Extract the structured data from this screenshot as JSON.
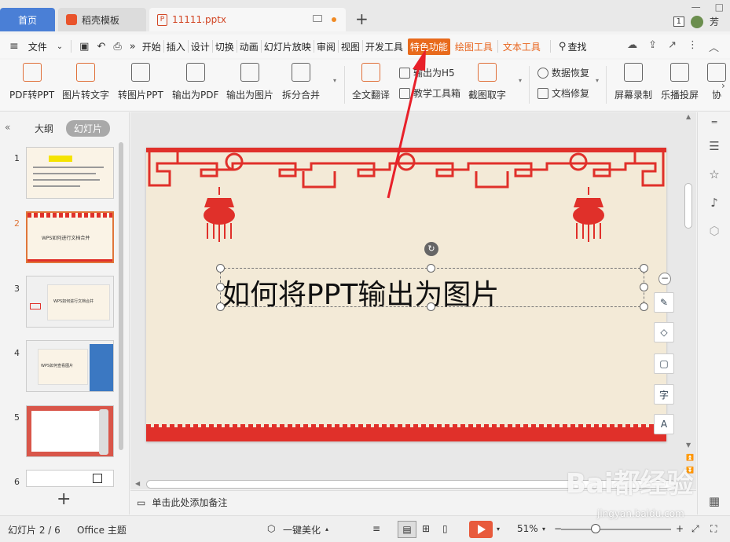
{
  "tabs": {
    "home": "首页",
    "template": "稻壳模板",
    "doc": "11111.pptx",
    "new_tab": "+"
  },
  "user": {
    "badge": "1",
    "name": "芳"
  },
  "menu": {
    "file": "文件",
    "items": [
      "开始",
      "插入",
      "设计",
      "切换",
      "动画",
      "幻灯片放映",
      "审阅",
      "视图",
      "开发工具"
    ],
    "special": "特色功能",
    "drawing": "绘图工具",
    "text_tool": "文本工具",
    "search": "查找"
  },
  "ribbon": {
    "pdf2ppt": "PDF转PPT",
    "img2text": "图片转文字",
    "img2ppt": "转图片PPT",
    "export_pdf": "输出为PDF",
    "export_img": "输出为图片",
    "split_merge": "拆分合并",
    "translate": "全文翻译",
    "export_h5": "输出为H5",
    "teach_tools": "教学工具箱",
    "screenshot": "截图取字",
    "data_recover": "数据恢复",
    "doc_repair": "文档修复",
    "screen_record": "屏幕录制",
    "cast": "乐播投屏",
    "collab": "协"
  },
  "left_panel": {
    "outline_tab": "大纲",
    "slides_tab": "幻灯片",
    "slide_numbers": [
      "1",
      "2",
      "3",
      "4",
      "5",
      "6"
    ],
    "thumb2_caption": "WPS如何进行文档合并",
    "thumb3_caption": "WPS如何进行文档合并",
    "thumb4_caption": "WPS如何查看图片"
  },
  "slide": {
    "title": "如何将PPT输出为图片"
  },
  "notes_placeholder": "单击此处添加备注",
  "status": {
    "slide_counter": "幻灯片 2 / 6",
    "theme": "Office 主题",
    "beautify": "一键美化",
    "zoom": "51%"
  },
  "watermark": {
    "text": "Bai都经验",
    "sub": "jingyan.baidu.com"
  },
  "colors": {
    "accent": "#e86a1c",
    "tab_blue": "#4a7fd6",
    "slide_red": "#e0302a",
    "slide_bg": "#f3ead7"
  }
}
